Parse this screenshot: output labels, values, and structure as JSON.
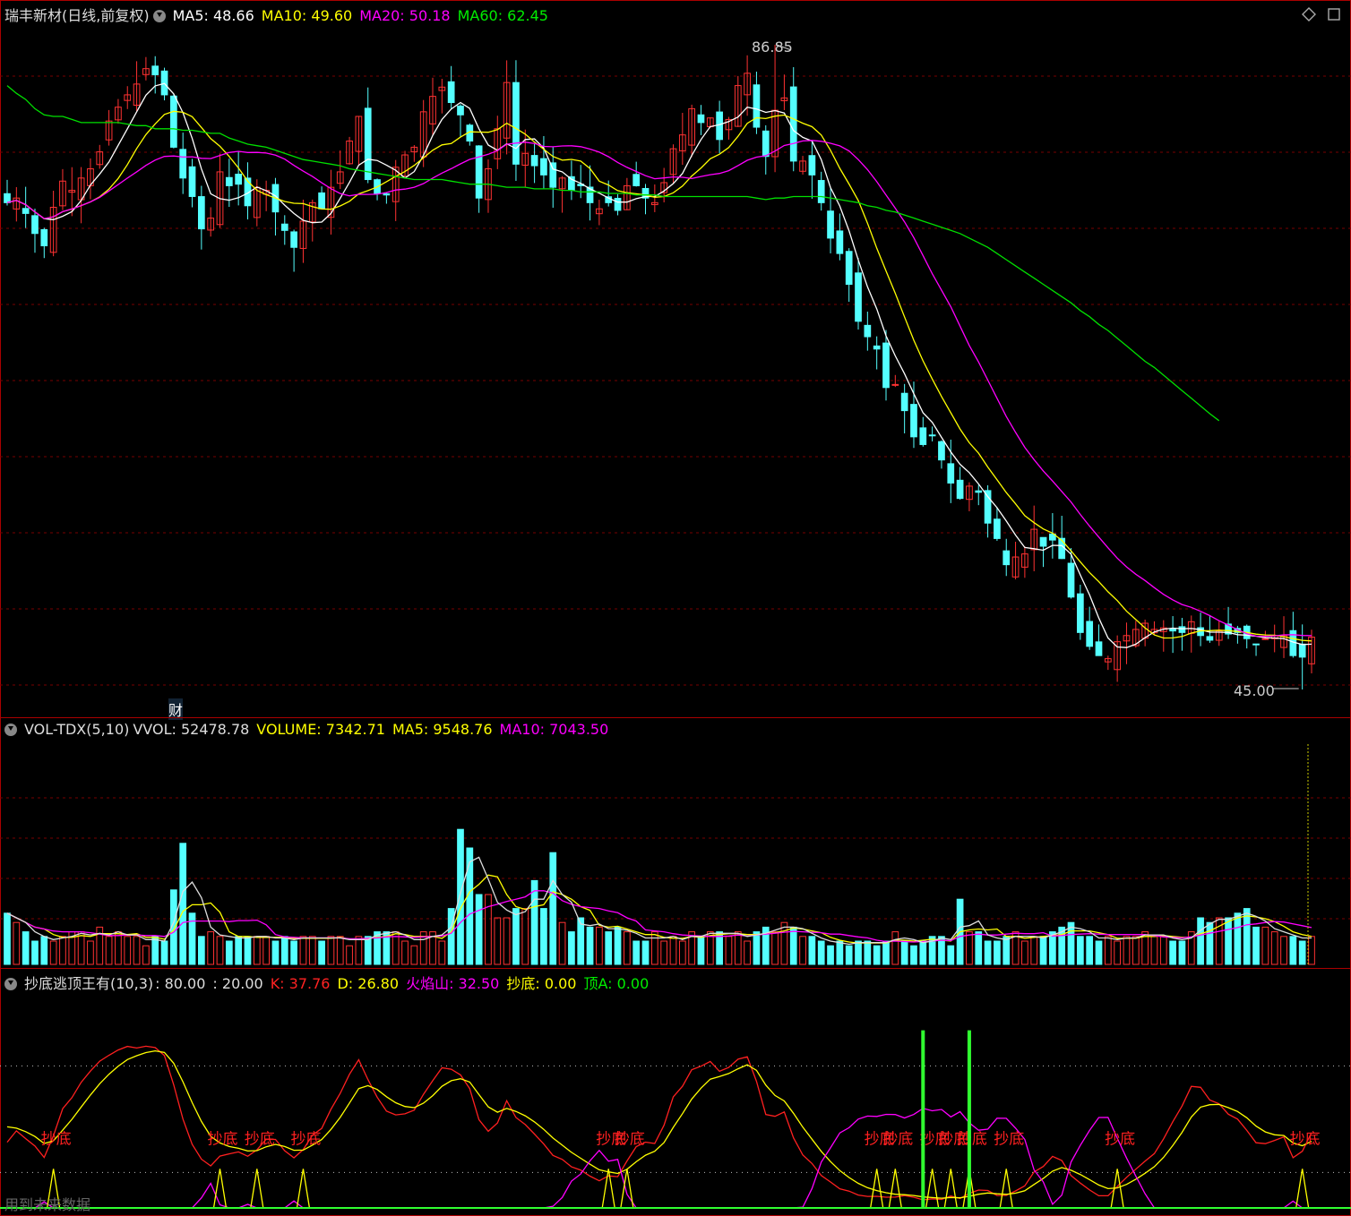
{
  "main": {
    "title": "瑞丰新材(日线,前复权)",
    "ma5": "MA5: 48.66",
    "ma10": "MA10: 49.60",
    "ma20": "MA20: 50.18",
    "ma60": "MA60: 62.45",
    "high_label": "86.85",
    "low_label": "45.00",
    "fin_marker": "财",
    "corner_icon": "diamond-icon"
  },
  "vol": {
    "name": "VOL-TDX(5,10)",
    "vvol": "VVOL: 52478.78",
    "volume": "VOLUME: 7342.71",
    "ma5": "MA5: 9548.76",
    "ma10": "MA10: 7043.50"
  },
  "ind": {
    "name": "抄底逃顶王有(10,3)",
    "p1": ": 80.00",
    "p2": ": 20.00",
    "k": "K: 37.76",
    "d": "D: 26.80",
    "fire": "火焰山: 32.50",
    "bottom": "抄底: 0.00",
    "top": "顶A: 0.00",
    "signal_label": "抄底",
    "footer": "用到未来数据"
  },
  "colors": {
    "up": "#ff3232",
    "down": "#54ffff",
    "ma5": "#ffffff",
    "ma10": "#ffff00",
    "ma20": "#ff00ff",
    "ma60": "#00e000",
    "frame": "#a00000"
  },
  "chart_data": [
    {
      "type": "candlestick",
      "title": "瑞丰新材(日线,前复权)",
      "ylim": [
        45.0,
        86.85
      ],
      "annotations": [
        "86.85",
        "45.00"
      ],
      "series": [
        {
          "name": "MA5",
          "last": 48.66
        },
        {
          "name": "MA10",
          "last": 49.6
        },
        {
          "name": "MA20",
          "last": 50.18
        },
        {
          "name": "MA60",
          "last": 62.45
        }
      ],
      "close": [
        76.6,
        76.9,
        75.9,
        74.6,
        73.8,
        76.3,
        78.0,
        77.4,
        78.2,
        78.8,
        79.9,
        81.9,
        82.8,
        83.6,
        84.3,
        85.3,
        84.9,
        83.6,
        80.2,
        78.2,
        77.0,
        74.9,
        75.6,
        78.6,
        77.7,
        77.8,
        76.4,
        77.6,
        77.4,
        76.0,
        74.8,
        73.7,
        75.4,
        76.6,
        76.2,
        77.6,
        78.6,
        80.6,
        82.2,
        78.1,
        77.2,
        77.1,
        78.9,
        79.7,
        80.2,
        82.5,
        83.5,
        84.1,
        83.1,
        82.3,
        80.6,
        76.9,
        78.8,
        81.4,
        84.4,
        79.1,
        79.8,
        79.0,
        78.4,
        77.6,
        78.2,
        77.4,
        77.7,
        76.6,
        76.2,
        76.6,
        76.1,
        77.7,
        77.7,
        76.9,
        76.6,
        77.9,
        80.1,
        81.0,
        82.7,
        81.8,
        82.1,
        80.7,
        82.0,
        84.2,
        85.0,
        81.5,
        79.6,
        82.6,
        83.4,
        79.3,
        79.3,
        78.4,
        76.6,
        74.3,
        73.3,
        71.3,
        68.9,
        67.9,
        67.1,
        64.6,
        64.8,
        63.1,
        61.4,
        60.9,
        61.5,
        59.9,
        58.4,
        57.4,
        58.2,
        57.8,
        55.8,
        54.8,
        53.1,
        53.6,
        53.8,
        55.4,
        54.3,
        54.7,
        53.5,
        51.0,
        48.7,
        47.8,
        47.2,
        47.0,
        48.1,
        48.5,
        48.9,
        49.3,
        48.9,
        49.0,
        48.8,
        48.7,
        49.4,
        48.5,
        48.2,
        48.8,
        48.6,
        48.7,
        48.3,
        47.9,
        48.3,
        48.5,
        48.5,
        47.2,
        47.1,
        48.4
      ],
      "ma60": [
        84.2,
        83.7,
        83.3,
        82.7,
        82.3,
        82.2,
        82.2,
        82.0,
        81.8,
        81.8,
        81.8,
        81.8,
        81.8,
        81.7,
        81.6,
        81.6,
        81.4,
        81.4,
        81.4,
        81.3,
        81.3,
        81.2,
        81.1,
        81.1,
        80.8,
        80.6,
        80.4,
        80.3,
        80.2,
        80.0,
        79.8,
        79.6,
        79.4,
        79.3,
        79.2,
        79.1,
        79.0,
        78.8,
        78.7,
        78.6,
        78.5,
        78.4,
        78.3,
        78.2,
        78.1,
        78.1,
        78.1,
        78.1,
        78.0,
        77.9,
        77.8,
        77.8,
        77.8,
        77.7,
        77.6,
        77.6,
        77.6,
        77.5,
        77.5,
        77.5,
        77.4,
        77.4,
        77.3,
        77.3,
        77.3,
        77.2,
        77.2,
        77.2,
        77.1,
        77.1,
        77.1,
        77.0,
        77.0,
        77.0,
        77.0,
        77.0,
        77.0,
        77.0,
        77.0,
        77.0,
        77.0,
        76.9,
        76.8,
        76.9,
        76.9,
        77.0,
        77.0,
        77.0,
        77.0,
        76.9,
        76.8,
        76.7,
        76.6,
        76.4,
        76.3,
        76.1,
        76.0,
        75.8,
        75.6,
        75.4,
        75.2,
        75.0,
        74.8,
        74.6,
        74.3,
        74.0,
        73.7,
        73.3,
        72.9,
        72.5,
        72.1,
        71.7,
        71.3,
        70.9,
        70.5,
        70.1,
        69.6,
        69.2,
        68.7,
        68.3,
        67.8,
        67.3,
        66.8,
        66.3,
        65.9,
        65.4,
        64.9,
        64.4,
        63.9,
        63.4,
        62.9,
        62.45
      ]
    },
    {
      "type": "bar",
      "title": "VOL-TDX(5,10)",
      "series": [
        {
          "name": "VVOL",
          "last": 52478.78
        },
        {
          "name": "VOLUME",
          "last": 7342.71
        },
        {
          "name": "MA5",
          "last": 9548.76
        },
        {
          "name": "MA10",
          "last": 7043.5
        }
      ],
      "values": [
        11,
        9,
        7,
        5,
        6,
        5,
        6,
        7,
        7,
        5,
        8,
        6,
        7,
        6,
        6,
        4,
        6,
        5,
        16,
        26,
        11,
        6,
        7,
        6,
        5,
        6,
        6,
        6,
        6,
        5,
        6,
        5,
        6,
        6,
        5,
        6,
        6,
        4,
        6,
        6,
        7,
        7,
        7,
        5,
        4,
        7,
        7,
        5,
        12,
        29,
        25,
        15,
        15,
        10,
        10,
        12,
        12,
        18,
        12,
        24,
        9,
        7,
        10,
        8,
        8,
        7,
        8,
        7,
        5,
        5,
        7,
        5,
        6,
        5,
        7,
        6,
        7,
        7,
        6,
        7,
        5,
        7,
        8,
        7,
        9,
        8,
        6,
        6,
        5,
        4,
        5,
        4,
        5,
        5,
        4,
        5,
        7,
        5,
        4,
        5,
        6,
        6,
        4,
        14,
        7,
        7,
        5,
        5,
        6,
        7,
        5,
        6,
        6,
        7,
        8,
        9,
        6,
        6,
        5,
        6,
        5,
        6,
        6,
        7,
        6,
        6,
        5,
        5,
        7,
        10,
        9,
        10,
        10,
        11,
        12,
        8,
        8,
        7,
        6,
        6,
        5,
        6,
        6,
        5,
        6,
        5,
        6,
        5,
        7,
        6,
        14,
        15,
        7
      ]
    },
    {
      "type": "line",
      "title": "抄底逃顶王有(10,3)",
      "ylim": [
        0,
        120
      ],
      "series": [
        {
          "name": "K",
          "last": 37.76
        },
        {
          "name": "D",
          "last": 26.8
        },
        {
          "name": "火焰山",
          "last": 32.5
        },
        {
          "name": "抄底",
          "last": 0.0
        },
        {
          "name": "顶A",
          "last": 0.0
        }
      ]
    }
  ]
}
